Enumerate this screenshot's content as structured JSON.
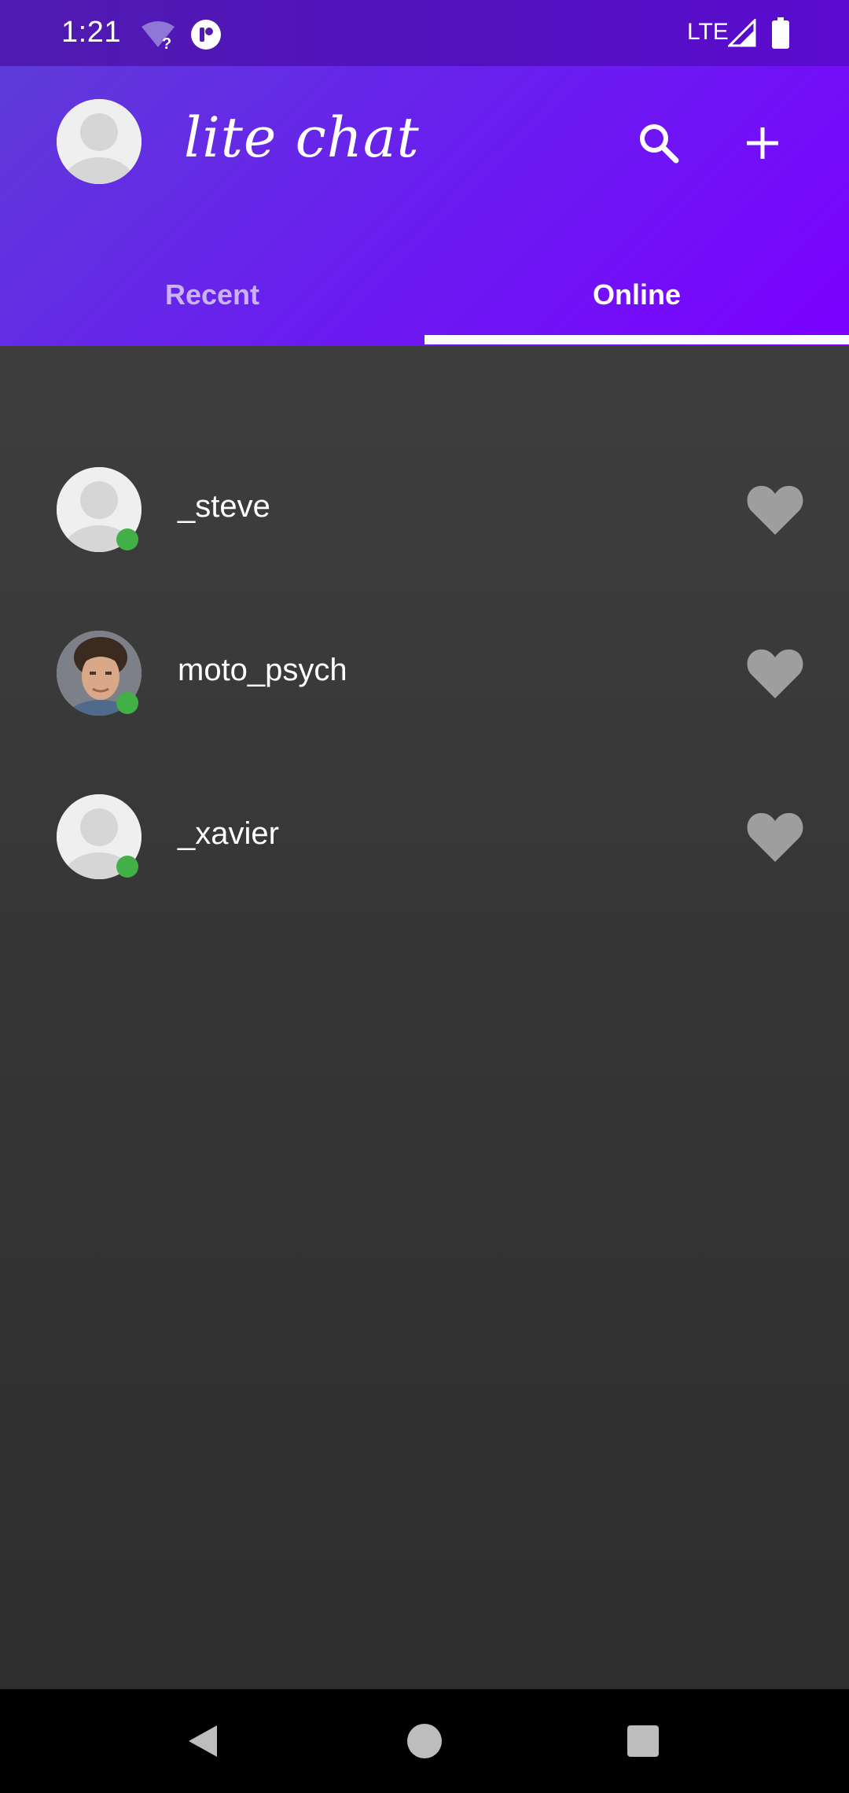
{
  "status_bar": {
    "time": "1:21",
    "network": "LTE",
    "icons": [
      "wifi-question-icon",
      "app-notification-icon",
      "signal-icon",
      "battery-icon"
    ]
  },
  "app_bar": {
    "title": "lite chat",
    "actions": [
      "search-icon",
      "add-icon"
    ]
  },
  "tabs": {
    "items": [
      {
        "label": "Recent",
        "selected": false
      },
      {
        "label": "Online",
        "selected": true
      }
    ]
  },
  "online_list": [
    {
      "name": "_steve",
      "avatar": "default-avatar",
      "online": true
    },
    {
      "name": "moto_psych",
      "avatar": "photo-avatar",
      "online": true
    },
    {
      "name": "_xavier",
      "avatar": "default-avatar",
      "online": true
    }
  ],
  "colors": {
    "accent_start": "#5e3bd8",
    "accent_end": "#7b00ff",
    "presence": "#43b047",
    "background": "#363636",
    "heart": "#9e9e9e"
  },
  "nav": [
    "back-icon",
    "home-icon",
    "recents-icon"
  ]
}
